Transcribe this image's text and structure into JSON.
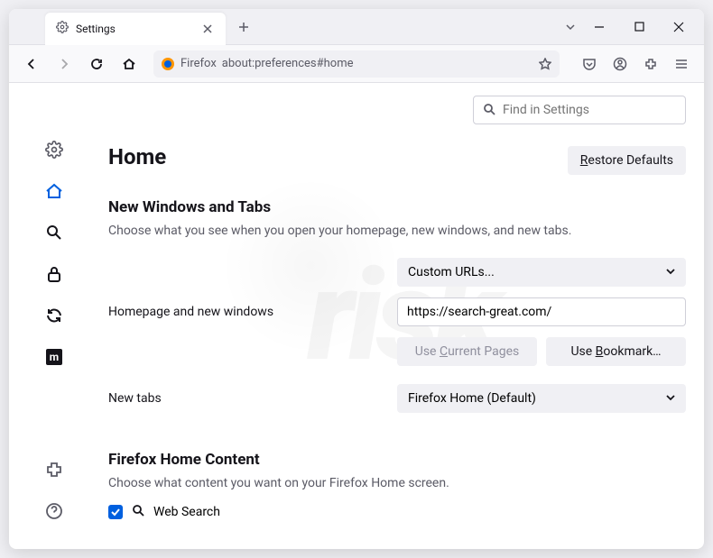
{
  "tab": {
    "title": "Settings"
  },
  "urlbar": {
    "label": "Firefox",
    "url": "about:preferences#home"
  },
  "find": {
    "placeholder": "Find in Settings"
  },
  "page": {
    "title": "Home",
    "restore": "Restore Defaults",
    "section1_title": "New Windows and Tabs",
    "section1_sub": "Choose what you see when you open your homepage, new windows, and new tabs.",
    "homepage_label": "Homepage and new windows",
    "homepage_select": "Custom URLs...",
    "homepage_value": "https://search-great.com/",
    "use_current": "Use Current Pages",
    "use_bookmark": "Use Bookmark…",
    "newtabs_label": "New tabs",
    "newtabs_select": "Firefox Home (Default)",
    "section2_title": "Firefox Home Content",
    "section2_sub": "Choose what content you want on your Firefox Home screen.",
    "websearch": "Web Search"
  }
}
